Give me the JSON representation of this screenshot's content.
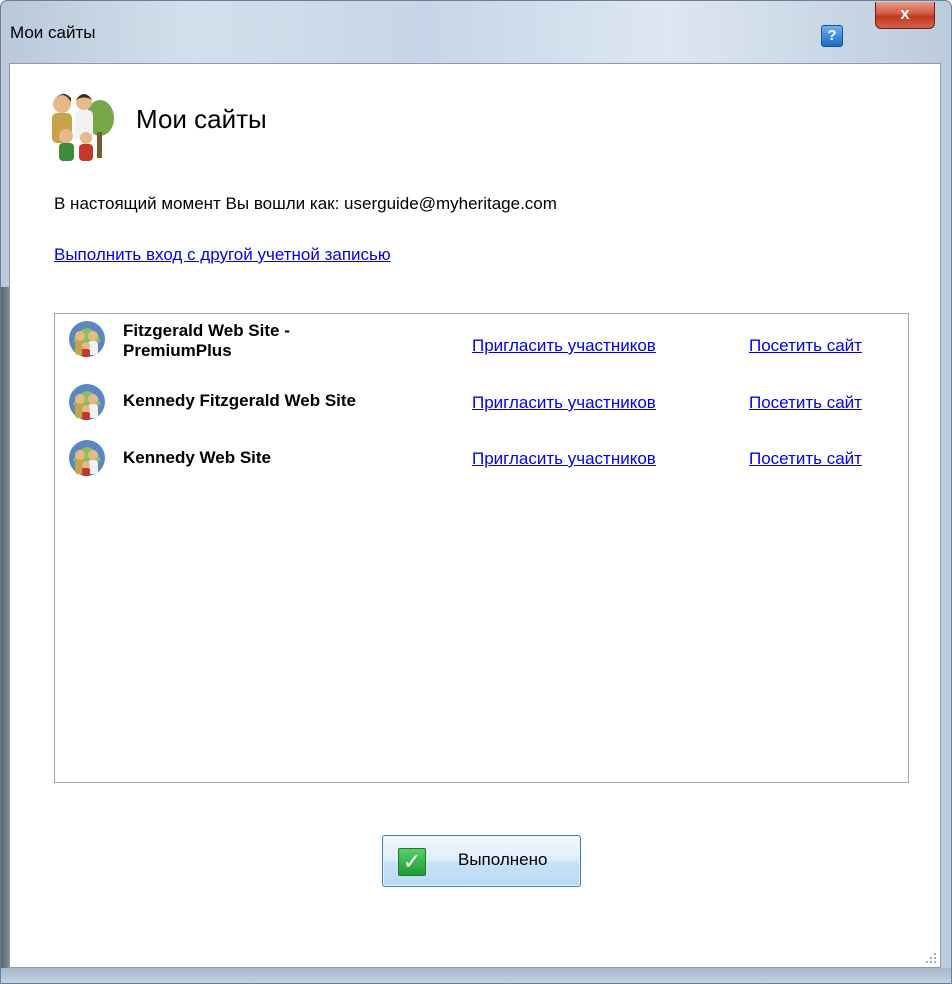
{
  "window": {
    "title": "Мои сайты",
    "help_label": "?",
    "close_label": "x"
  },
  "header": {
    "title": "Мои сайты"
  },
  "login": {
    "status_text": "В настоящий момент Вы вошли как: userguide@myheritage.com",
    "switch_account_link": "Выполнить вход с другой учетной записью"
  },
  "sites": [
    {
      "name": "Fitzgerald Web Site - PremiumPlus",
      "invite_link": "Пригласить участников",
      "visit_link": "Посетить сайт"
    },
    {
      "name": "Kennedy Fitzgerald Web Site",
      "invite_link": "Пригласить участников",
      "visit_link": "Посетить сайт"
    },
    {
      "name": "Kennedy Web Site",
      "invite_link": "Пригласить участников",
      "visit_link": "Посетить сайт"
    }
  ],
  "footer": {
    "done_label": "Выполнено",
    "done_icon": "check-icon"
  },
  "colors": {
    "link": "#0000ee",
    "close_button": "#c0391f",
    "done_check": "#1f9a33",
    "help_button": "#1b69c8"
  }
}
